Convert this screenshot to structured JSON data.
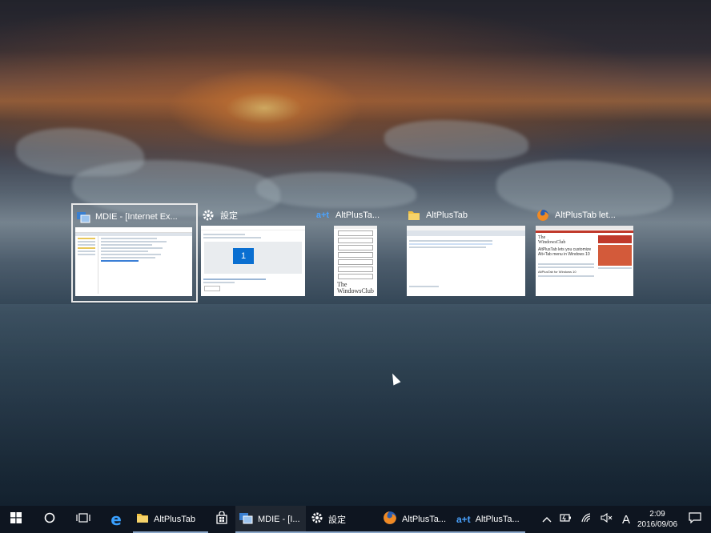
{
  "switcher": {
    "windows": [
      {
        "title": "MDIE - [Internet Ex...",
        "icon": "mdie-icon",
        "selected": true
      },
      {
        "title": "設定",
        "icon": "gear-icon",
        "selected": false
      },
      {
        "title": "AltPlusTa...",
        "icon": "altplustab-icon",
        "selected": false
      },
      {
        "title": "AltPlusTab",
        "icon": "folder-icon",
        "selected": false
      },
      {
        "title": "AltPlusTab let...",
        "icon": "firefox-icon",
        "selected": false
      }
    ],
    "thumb_text": {
      "settings_number": "1",
      "altplustab_logo": "The WindowsClub",
      "firefox_logo_line1": "The",
      "firefox_logo_line2": "WindowsClub",
      "firefox_headline": "AltPlusTab lets you customize Alt+Tab menu in Windows 10",
      "firefox_subhead": "AltPlusTab for Windows 10"
    }
  },
  "taskbar": {
    "apps": [
      {
        "label": "",
        "icon": "windows-start-icon"
      },
      {
        "label": "",
        "icon": "cortana-circle-icon"
      },
      {
        "label": "",
        "icon": "task-view-icon"
      },
      {
        "label": "",
        "icon": "edge-icon"
      },
      {
        "label": "AltPlusTab",
        "icon": "folder-icon"
      },
      {
        "label": "",
        "icon": "store-icon"
      },
      {
        "label": "MDIE - [I...",
        "icon": "mdie-icon"
      },
      {
        "label": "設定",
        "icon": "gear-icon"
      },
      {
        "label": "AltPlusTa...",
        "icon": "firefox-icon"
      },
      {
        "label": "AltPlusTa...",
        "icon": "altplustab-icon"
      }
    ],
    "tray": {
      "ime": "A",
      "time": "2:09",
      "date": "2016/09/06"
    }
  },
  "colors": {
    "taskbar": "#0e1520",
    "selection_border": "#e8e8e8",
    "accent": "#0a6fd1"
  }
}
